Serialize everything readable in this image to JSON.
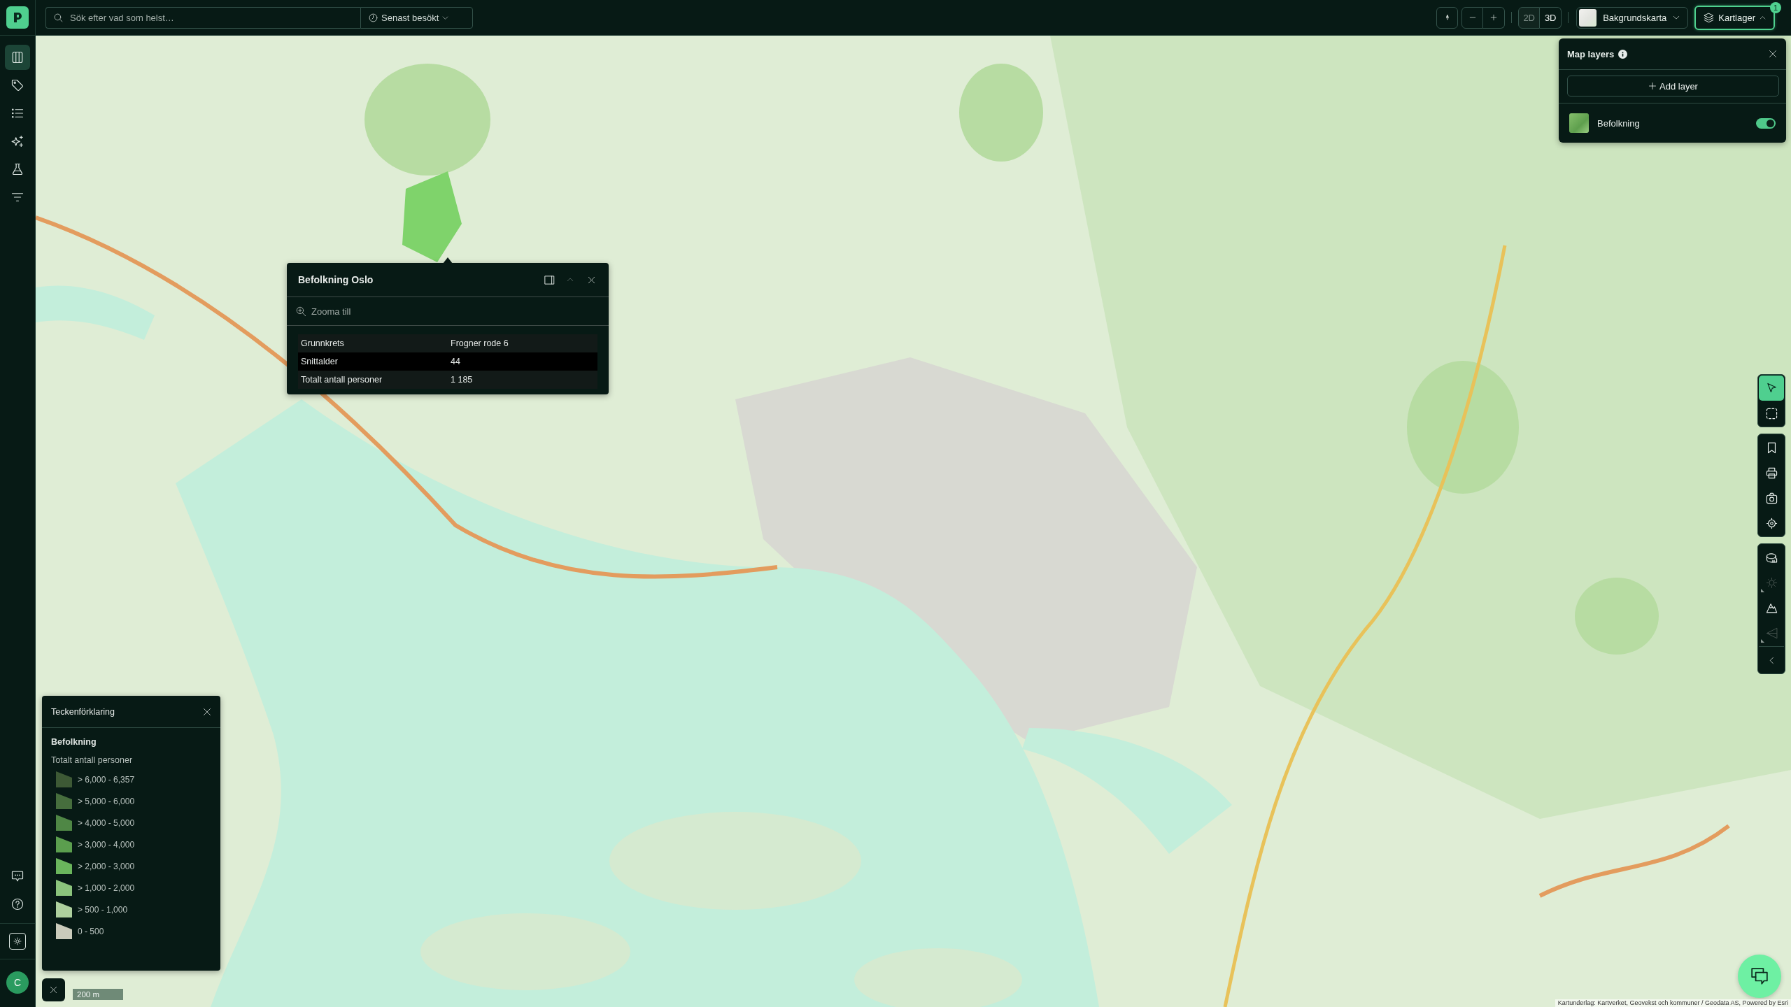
{
  "top_bar": {
    "search": {
      "placeholder": "Sök efter vad som helst…"
    },
    "recent_dropdown": {
      "label": "Senast besökt"
    },
    "view_modes": [
      {
        "label": "2D",
        "selected": true
      },
      {
        "label": "3D",
        "selected": false
      }
    ],
    "basemap": {
      "label": "Bakgrundskarta"
    },
    "layers_button": {
      "label": "Kartlager",
      "expanded": true,
      "badge": "1"
    }
  },
  "sidebar": {
    "items": [
      {
        "selected": true
      },
      {
        "selected": false
      },
      {
        "selected": false
      },
      {
        "selected": false
      },
      {
        "selected": false
      },
      {
        "selected": false
      }
    ],
    "user": {
      "initial": "C"
    }
  },
  "map_layers_panel": {
    "title": "Map layers",
    "add_button": "Add layer",
    "layers": [
      {
        "name": "Befolkning",
        "visible": true
      }
    ]
  },
  "popup": {
    "title": "Befolkning Oslo",
    "action": "Zooma till",
    "fields": [
      {
        "label": "Grunnkrets",
        "value": "Frogner rode 6"
      },
      {
        "label": "Snittalder",
        "value": "44"
      },
      {
        "label": "Totalt antall personer",
        "value": "1 185"
      }
    ]
  },
  "toolbar": {
    "groups": [
      {
        "tools": [
          {
            "selected": true,
            "disabled": false,
            "flyout": false
          },
          {
            "selected": false,
            "disabled": false,
            "flyout": false
          }
        ]
      },
      {
        "tools": [
          {
            "selected": false,
            "disabled": false,
            "flyout": false
          },
          {
            "selected": false,
            "disabled": false,
            "flyout": false
          },
          {
            "selected": false,
            "disabled": false,
            "flyout": false
          },
          {
            "selected": false,
            "disabled": false,
            "flyout": false
          }
        ]
      },
      {
        "tools": [
          {
            "selected": false,
            "disabled": false,
            "flyout": false
          },
          {
            "selected": false,
            "disabled": true,
            "flyout": true
          },
          {
            "selected": false,
            "disabled": false,
            "flyout": false
          },
          {
            "selected": false,
            "disabled": true,
            "flyout": true
          }
        ]
      }
    ]
  },
  "legend": {
    "title": "Teckenförklaring",
    "layer": "Befolkning",
    "field": "Totalt antall personer",
    "items": [
      {
        "label": "> 6,000 - 6,357",
        "color": "#3d5935"
      },
      {
        "label": "> 5,000 - 6,000",
        "color": "#466e3d"
      },
      {
        "label": "> 4,000 - 5,000",
        "color": "#4f8745"
      },
      {
        "label": "> 3,000 - 4,000",
        "color": "#5b9e4e"
      },
      {
        "label": "> 2,000 - 3,000",
        "color": "#6ab55c"
      },
      {
        "label": "> 1,000 - 2,000",
        "color": "#8bc47c"
      },
      {
        "label": "> 500 - 1,000",
        "color": "#aed09e"
      },
      {
        "label": "0 - 500",
        "color": "#cacbbb"
      }
    ]
  },
  "scale_bar": {
    "label": "200 m"
  },
  "attribution": "Kartunderlag: Kartverket, Geovekst och kommuner / Geodata AS, Powered by Esri"
}
